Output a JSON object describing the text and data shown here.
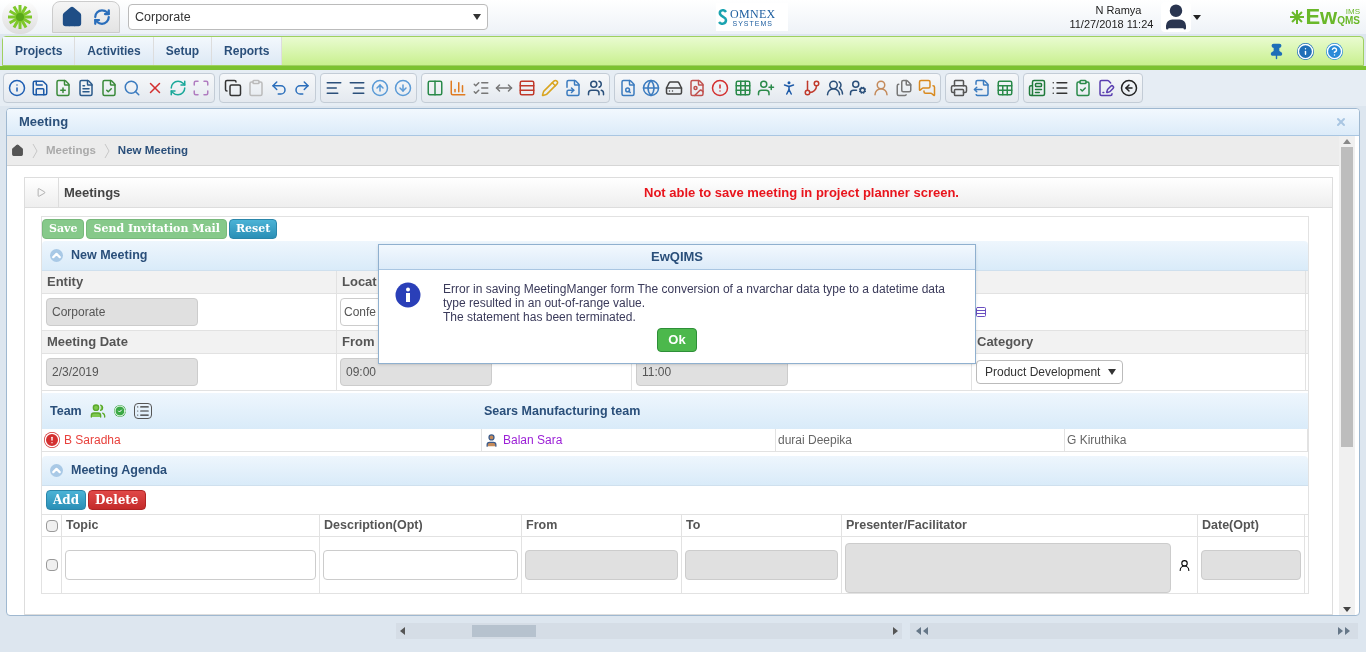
{
  "header": {
    "entity_select": "Corporate",
    "company_logo": {
      "name": "OMNEX",
      "tagline": "SYSTEMS"
    },
    "user": {
      "name": "N Ramya",
      "datetime": "11/27/2018 11:24"
    },
    "product_logo": {
      "main": "Ew",
      "sub": "QMS",
      "sup": "IMS"
    }
  },
  "menu": [
    {
      "label": "Projects",
      "selected": false
    },
    {
      "label": "Activities",
      "selected": false
    },
    {
      "label": "Setup",
      "selected": false
    },
    {
      "label": "Reports",
      "selected": false
    }
  ],
  "panel": {
    "title": "Meeting",
    "breadcrumb": [
      {
        "label": "Meetings",
        "current": false
      },
      {
        "label": "New Meeting",
        "current": true
      }
    ]
  },
  "section": {
    "title": "Meetings",
    "note": "Not able to save meeting in project planner screen."
  },
  "actions": [
    {
      "label": "Save",
      "kind": "success",
      "disabled": true
    },
    {
      "label": "Send Invitation Mail",
      "kind": "success",
      "disabled": true
    },
    {
      "label": "Reset",
      "kind": "info",
      "disabled": false
    }
  ],
  "new_meeting": {
    "title": "New Meeting",
    "rows": [
      [
        {
          "label": "Entity",
          "value": "Corporate",
          "kind": "readonly"
        },
        {
          "label": "Locat",
          "value": "Confe",
          "kind": "text"
        },
        {
          "kind": "blank"
        },
        {
          "kind": "icon"
        }
      ],
      [
        {
          "label": "Meeting Date",
          "value": "2/3/2019",
          "kind": "readonly"
        },
        {
          "label": "From",
          "value": "09:00",
          "kind": "readonly"
        },
        {
          "value": "11:00",
          "kind": "readonly"
        },
        {
          "label": "Category",
          "value": "Product Development",
          "kind": "select"
        }
      ]
    ]
  },
  "team": {
    "label": "Team",
    "group": "Sears Manufacturing team",
    "members": [
      {
        "name": "B Saradha",
        "color": "#e8413c",
        "kind": "alert"
      },
      {
        "name": "Balan Sara",
        "color": "#9b1fd6",
        "kind": "person"
      },
      {
        "name": "durai Deepika",
        "color": "#666666",
        "kind": "plain"
      },
      {
        "name": "G Kiruthika",
        "color": "#666666",
        "kind": "plain"
      }
    ]
  },
  "agenda": {
    "title": "Meeting Agenda",
    "buttons": [
      {
        "label": "Add",
        "kind": "info"
      },
      {
        "label": "Delete",
        "kind": "danger"
      }
    ],
    "select_all": {
      "checked": false
    },
    "columns": [
      "Topic",
      "Description(Opt)",
      "From",
      "To",
      "Presenter/Facilitator",
      "Date(Opt)"
    ],
    "rows": [
      {
        "checked": false,
        "cells": [
          {
            "kind": "text"
          },
          {
            "kind": "text"
          },
          {
            "kind": "readonly"
          },
          {
            "kind": "readonly"
          },
          {
            "kind": "picker"
          },
          {
            "kind": "readonly"
          }
        ]
      }
    ]
  },
  "dialog": {
    "title": "EwQIMS",
    "message": [
      "Error in saving MeetingManger form The conversion of a nvarchar data type to a datetime data type resulted in an out-of-range value.",
      "The statement has been terminated."
    ],
    "button": "Ok"
  }
}
